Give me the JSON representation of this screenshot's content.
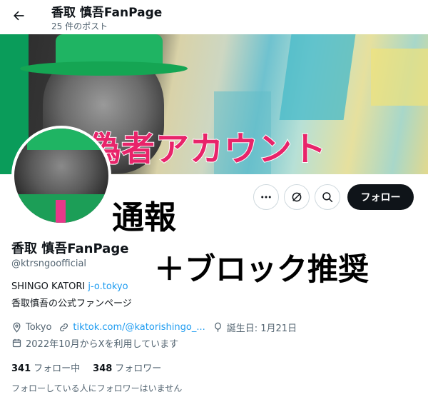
{
  "header": {
    "title": "香取 慎吾FanPage",
    "post_count": "25 件のポスト"
  },
  "overlays": {
    "fake_account": "偽者アカウント",
    "report": "通報",
    "block_recommend": "＋ブロック推奨"
  },
  "actions": {
    "more_icon": "more-icon",
    "grok_icon": "grok-icon",
    "search_icon": "search-icon",
    "follow_label": "フォロー"
  },
  "profile": {
    "name": "香取 慎吾FanPage",
    "handle": "@ktrsngoofficial",
    "bio_line1_text": "SHINGO KATORI ",
    "bio_line1_link": "j-o.tokyo",
    "bio_line2": "香取慎吾の公式ファンページ",
    "location": "Tokyo",
    "website": "tiktok.com/@katorishingo_...",
    "birthday": "誕生日: 1月21日",
    "joined": "2022年10月からXを利用しています"
  },
  "stats": {
    "following_count": "341",
    "following_label": "フォロー中",
    "followers_count": "348",
    "followers_label": "フォロワー"
  },
  "followers_you_know": "フォローしている人にフォロワーはいません",
  "colors": {
    "accent_link": "#1d9bf0",
    "overlay_pink": "#e8246a",
    "follow_button": "#0f1419"
  }
}
